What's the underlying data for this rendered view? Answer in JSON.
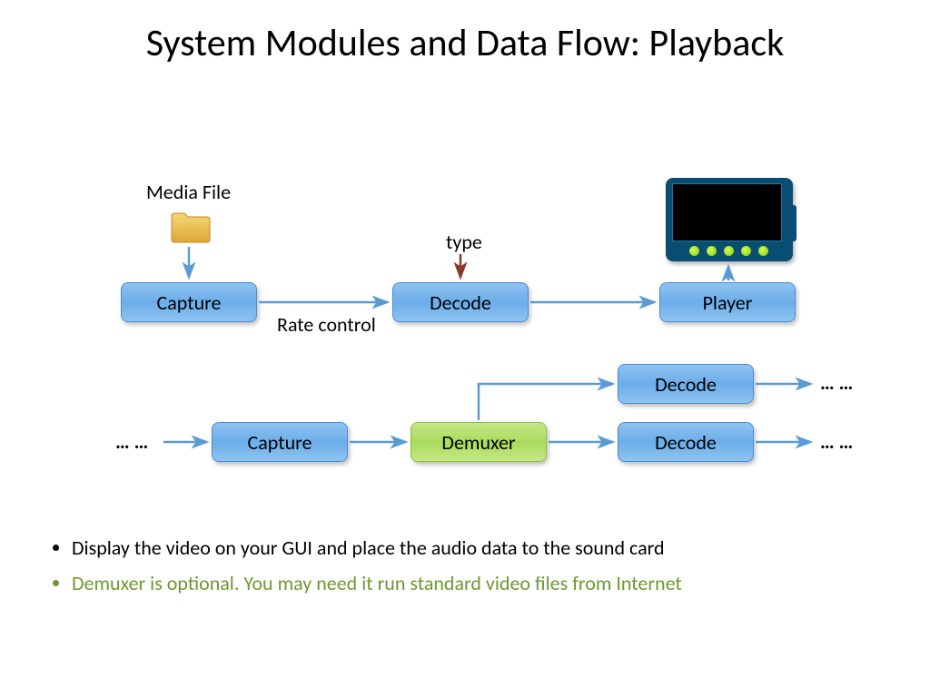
{
  "title": "System Modules and Data Flow: Playback",
  "labels": {
    "media_file": "Media File",
    "type": "type",
    "rate_control": "Rate control"
  },
  "row1": {
    "capture": "Capture",
    "decode": "Decode",
    "player": "Player"
  },
  "row2": {
    "capture": "Capture",
    "demuxer": "Demuxer",
    "decode1": "Decode",
    "decode2": "Decode"
  },
  "ellipsis": "… …",
  "bullets": {
    "b1": "Display the video on your GUI and place the audio data to the sound card",
    "b2": "Demuxer is optional. You may need it run standard video files from Internet"
  },
  "colors": {
    "arrow_blue": "#5a9bd5",
    "arrow_dark": "#8a3a2a"
  }
}
